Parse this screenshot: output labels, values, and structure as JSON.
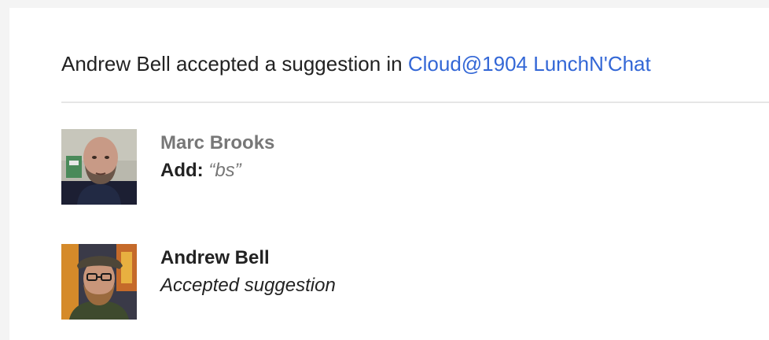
{
  "notification": {
    "actor": "Andrew Bell",
    "action_text": " accepted a suggestion in ",
    "document_link": "Cloud@1904 LunchN'Chat"
  },
  "suggestion": {
    "author": "Marc Brooks",
    "label": "Add:",
    "content": "“bs”"
  },
  "acceptance": {
    "author": "Andrew Bell",
    "status": "Accepted suggestion"
  },
  "colors": {
    "link": "#3367d6",
    "muted_name": "#777777",
    "text": "#222222",
    "divider": "#e6e6e6"
  }
}
